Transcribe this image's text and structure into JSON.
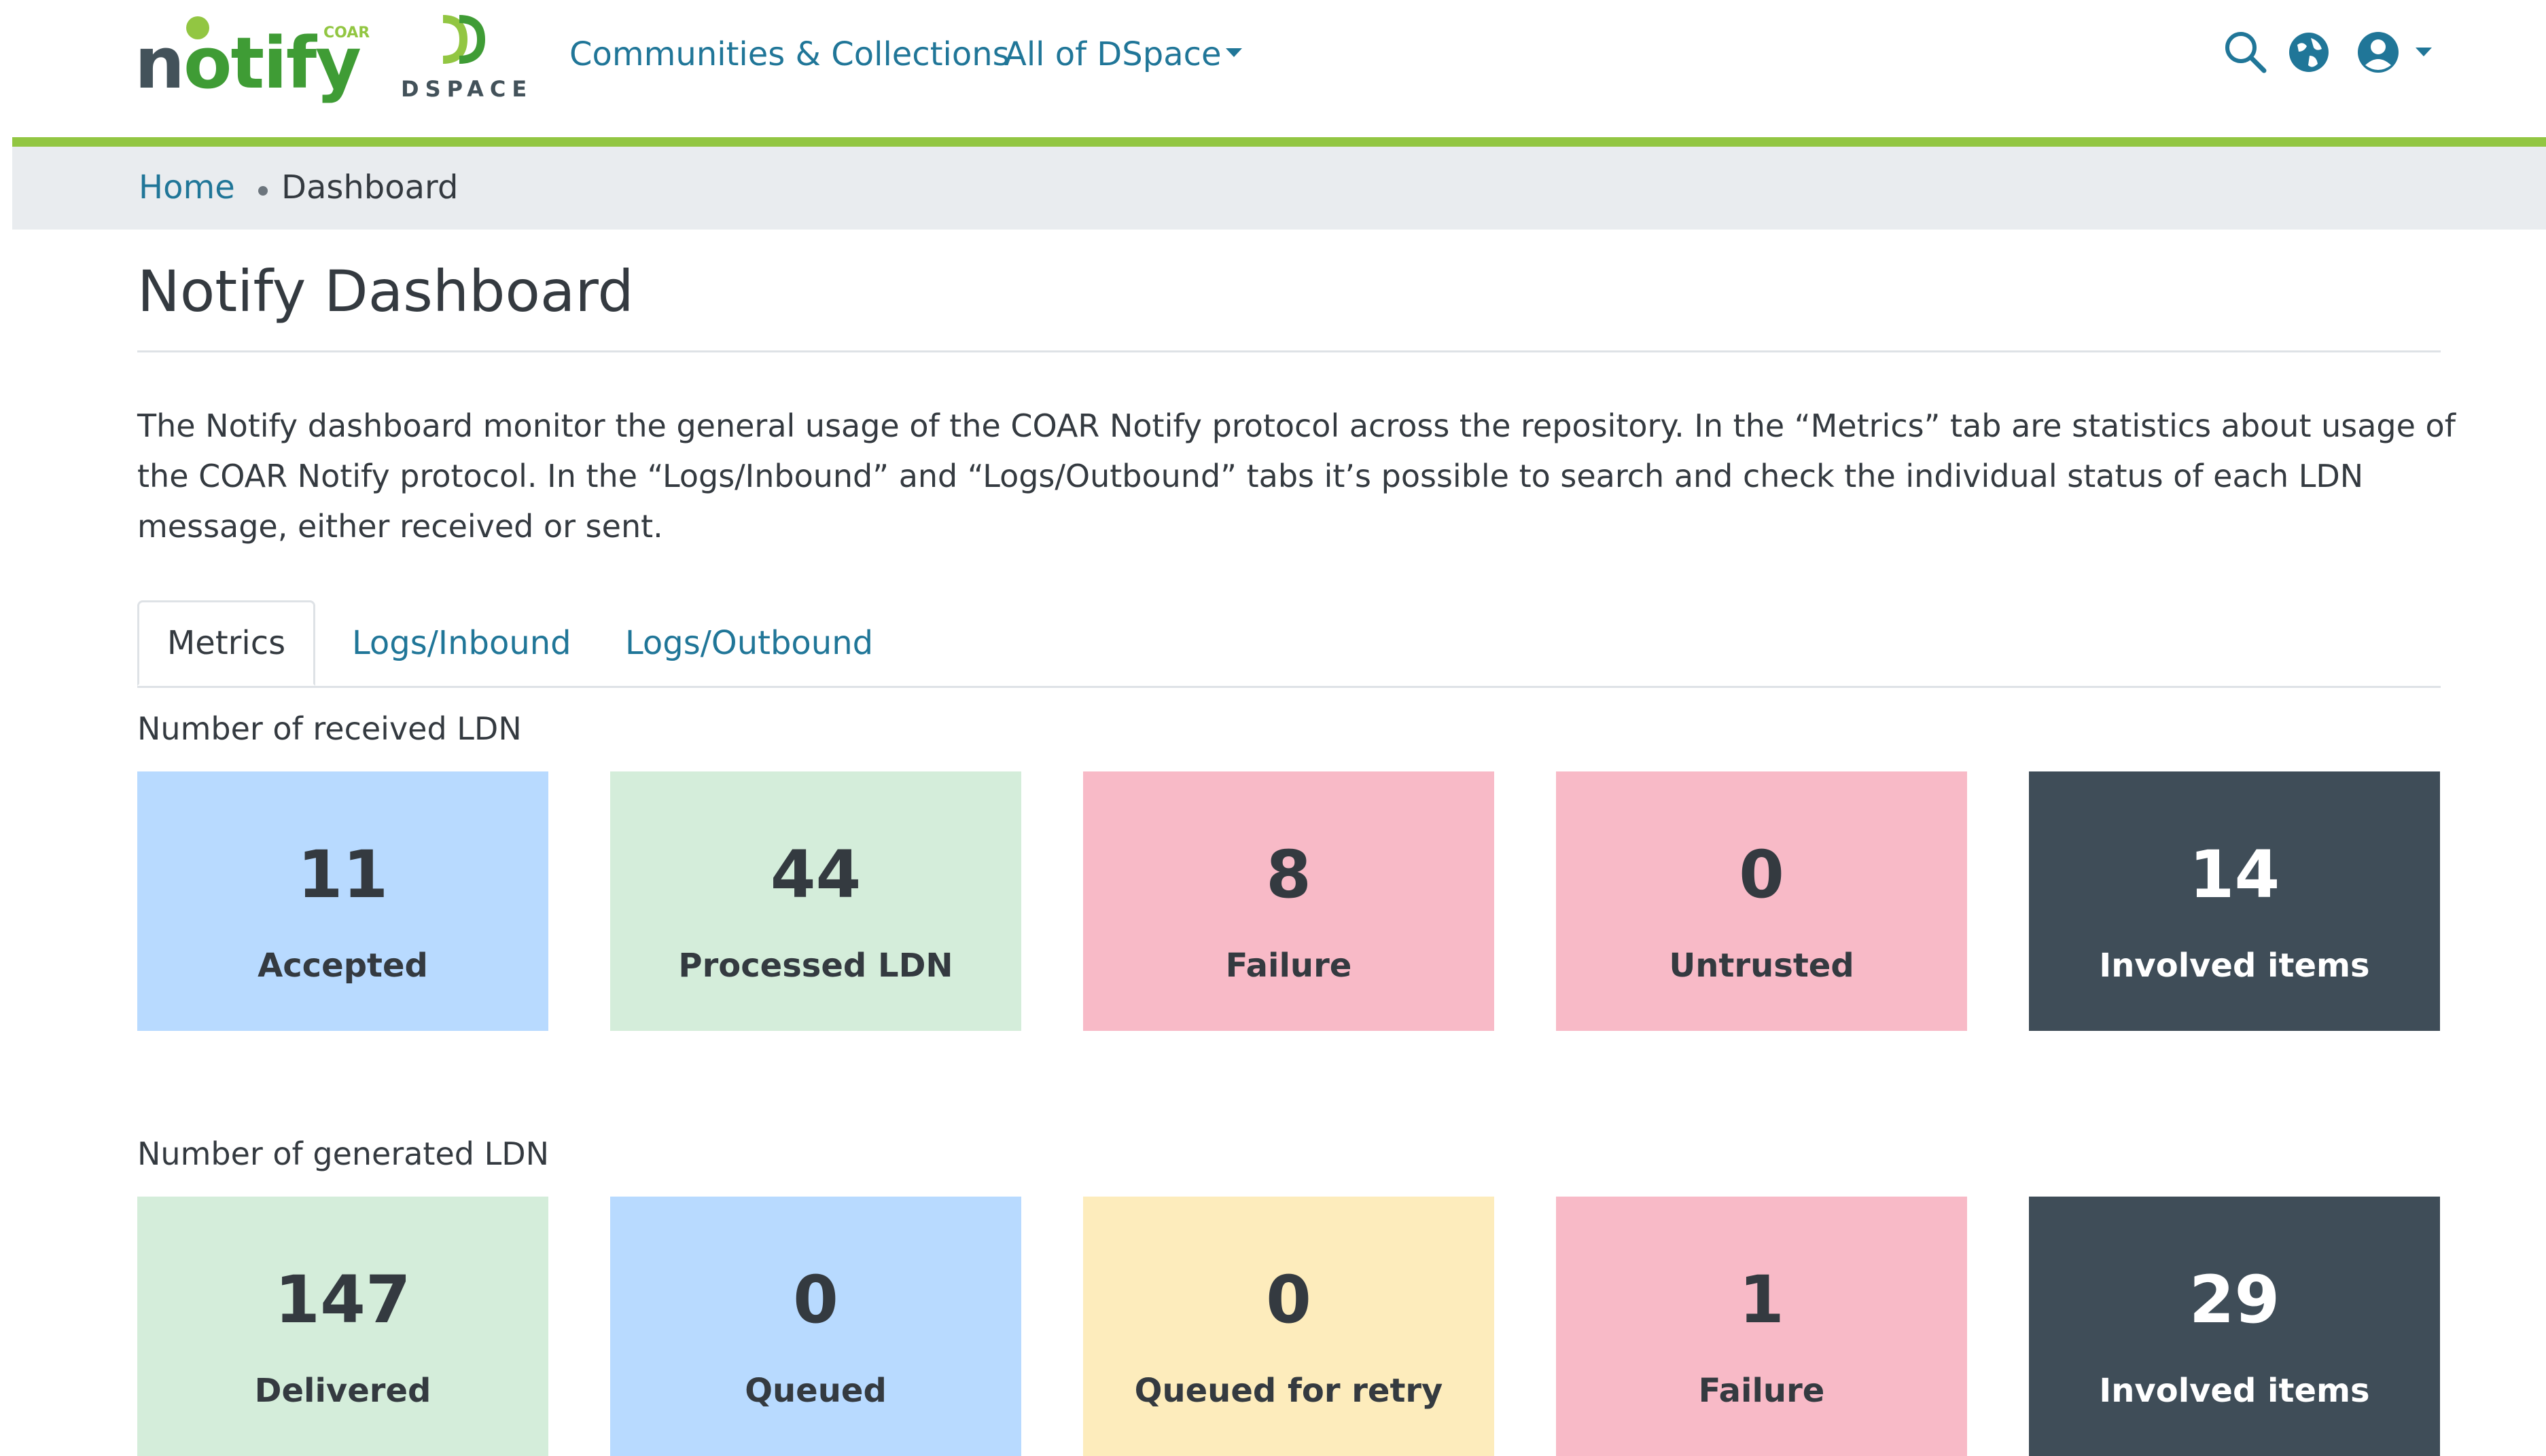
{
  "header": {
    "logo_notify_text": "notify",
    "logo_notify_sub": "COAR",
    "logo_dspace_text": "DSPACE",
    "nav": {
      "communities": "Communities & Collections",
      "all_dspace": "All of DSpace"
    },
    "icons": [
      "search-icon",
      "globe-icon",
      "user-icon"
    ]
  },
  "breadcrumb": {
    "home": "Home",
    "current": "Dashboard"
  },
  "page": {
    "title": "Notify Dashboard",
    "intro": "The Notify dashboard monitor the general usage of the COAR Notify protocol across the repository. In the “Metrics” tab are statistics about usage of the COAR Notify protocol. In the “Logs/Inbound” and “Logs/Outbound” tabs it’s possible to search and check the individual status of each LDN message, either received or sent."
  },
  "tabs": {
    "metrics": "Metrics",
    "inbound": "Logs/Inbound",
    "outbound": "Logs/Outbound",
    "active": "Metrics"
  },
  "received": {
    "label": "Number of received LDN",
    "cards": [
      {
        "value": "11",
        "label": "Accepted",
        "color": "#b8daff"
      },
      {
        "value": "44",
        "label": "Processed LDN",
        "color": "#d4edda"
      },
      {
        "value": "8",
        "label": "Failure",
        "color": "#f8bac7"
      },
      {
        "value": "0",
        "label": "Untrusted",
        "color": "#f8bac7"
      },
      {
        "value": "14",
        "label": "Involved items",
        "color": "#3f4d58"
      }
    ]
  },
  "generated": {
    "label": "Number of generated LDN",
    "cards": [
      {
        "value": "147",
        "label": "Delivered",
        "color": "#d4edda"
      },
      {
        "value": "0",
        "label": "Queued",
        "color": "#b8daff"
      },
      {
        "value": "0",
        "label": "Queued for retry",
        "color": "#fdecbc"
      },
      {
        "value": "1",
        "label": "Failure",
        "color": "#f8bac7"
      },
      {
        "value": "29",
        "label": "Involved items",
        "color": "#3f4d58"
      }
    ]
  },
  "colors": {
    "accent_green": "#92c642",
    "link": "#207698",
    "breadcrumb_bg": "#e9ecef"
  }
}
